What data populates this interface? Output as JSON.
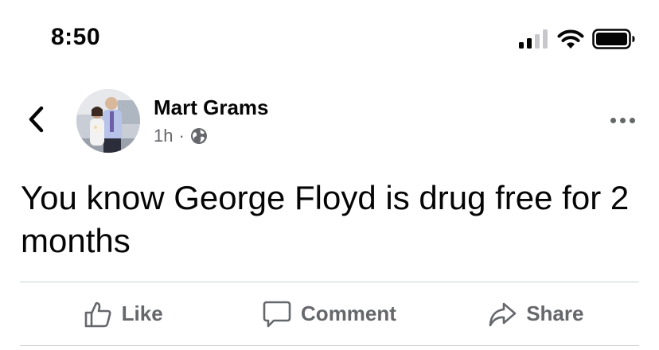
{
  "status_bar": {
    "time": "8:50",
    "icons": [
      "cellular-signal-icon",
      "wifi-icon",
      "battery-icon"
    ]
  },
  "post": {
    "author": "Mart Grams",
    "timestamp": "1h",
    "separator": "·",
    "audience_icon": "globe-icon",
    "text": "You know George Floyd is drug free for 2 months"
  },
  "actions": {
    "like_label": "Like",
    "comment_label": "Comment",
    "share_label": "Share"
  },
  "colors": {
    "text_primary": "#050505",
    "text_secondary": "#65676b",
    "divider": "#ced0d4"
  }
}
